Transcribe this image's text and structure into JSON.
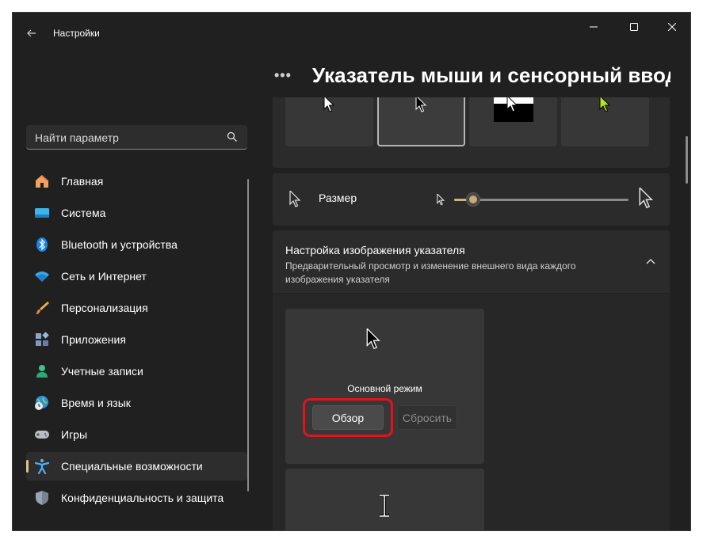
{
  "window": {
    "title": "Настройки",
    "controls": {
      "minimize": "minimize-icon",
      "maximize": "maximize-icon",
      "close": "close-icon"
    }
  },
  "search": {
    "placeholder": "Найти параметр",
    "icon": "search-icon"
  },
  "nav": {
    "items": [
      {
        "label": "Главная",
        "icon": "home-icon"
      },
      {
        "label": "Система",
        "icon": "system-display-icon"
      },
      {
        "label": "Bluetooth и устройства",
        "icon": "bluetooth-icon"
      },
      {
        "label": "Сеть и Интернет",
        "icon": "wifi-icon"
      },
      {
        "label": "Персонализация",
        "icon": "brush-icon"
      },
      {
        "label": "Приложения",
        "icon": "apps-icon"
      },
      {
        "label": "Учетные записи",
        "icon": "account-icon"
      },
      {
        "label": "Время и язык",
        "icon": "globe-clock-icon"
      },
      {
        "label": "Игры",
        "icon": "gamepad-icon"
      },
      {
        "label": "Специальные возможности",
        "icon": "accessibility-icon",
        "active": true
      },
      {
        "label": "Конфиденциальность и защита",
        "icon": "shield-icon"
      }
    ]
  },
  "breadcrumb": {
    "more": "•••",
    "title": "Указатель мыши и сенсорный ввод"
  },
  "pointer_styles": {
    "tiles": [
      {
        "name": "white",
        "icon": "white-arrow-cursor-icon"
      },
      {
        "name": "black",
        "icon": "black-arrow-cursor-icon",
        "selected": true
      },
      {
        "name": "inverted",
        "icon": "inverted-cursor-icon"
      },
      {
        "name": "custom",
        "icon": "custom-color-cursor-icon",
        "color": "#b5e61d"
      }
    ]
  },
  "size": {
    "label": "Размер",
    "value_fraction": 0.11
  },
  "customize": {
    "title": "Настройка изображения указателя",
    "description": "Предварительный просмотр и изменение внешнего вида каждого изображения указателя",
    "expanded": true,
    "tiles": [
      {
        "label": "Основной режим",
        "browse": "Обзор",
        "reset": "Сбросить"
      }
    ]
  },
  "colors": {
    "accent": "#d0b27f",
    "highlight": "#e0141e",
    "background": "#202020"
  }
}
